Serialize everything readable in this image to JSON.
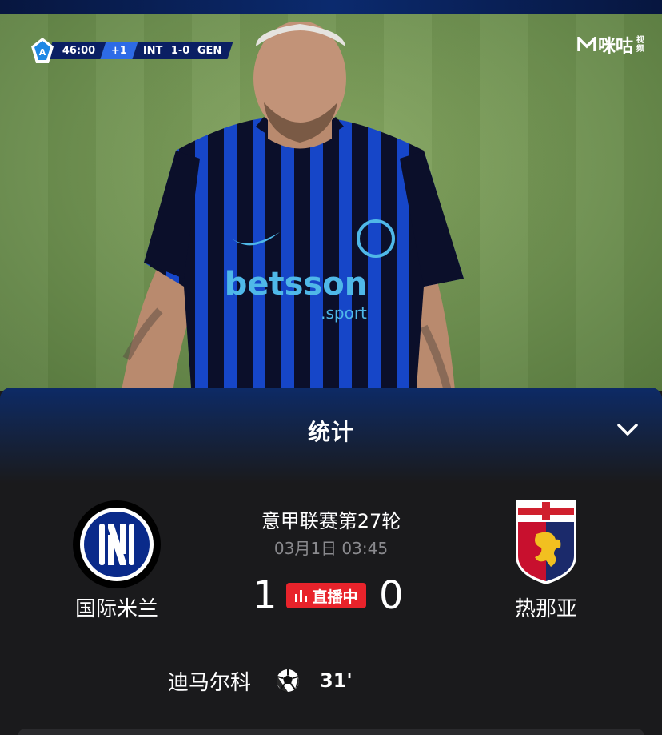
{
  "scorebug": {
    "clock": "46:00",
    "added_time": "+1",
    "home_abbr": "INT",
    "score": "1-0",
    "away_abbr": "GEN"
  },
  "brand": {
    "name": "咪咕",
    "suffix_line1": "视",
    "suffix_line2": "频"
  },
  "panel": {
    "title": "统计"
  },
  "match": {
    "round": "意甲联赛第27轮",
    "datetime": "03月1日 03:45",
    "status": "直播中",
    "home": {
      "name": "国际米兰",
      "score": "1",
      "color": "#0a2a8a"
    },
    "away": {
      "name": "热那亚",
      "score": "0",
      "color": "#c8102e"
    },
    "scorers": [
      {
        "name": "迪马尔科",
        "minute": "31'",
        "icon": "football-icon"
      }
    ]
  },
  "colors": {
    "live_red": "#e8232b",
    "panel_bg": "#1a1a1c",
    "muted_text": "#8a8a8e"
  }
}
